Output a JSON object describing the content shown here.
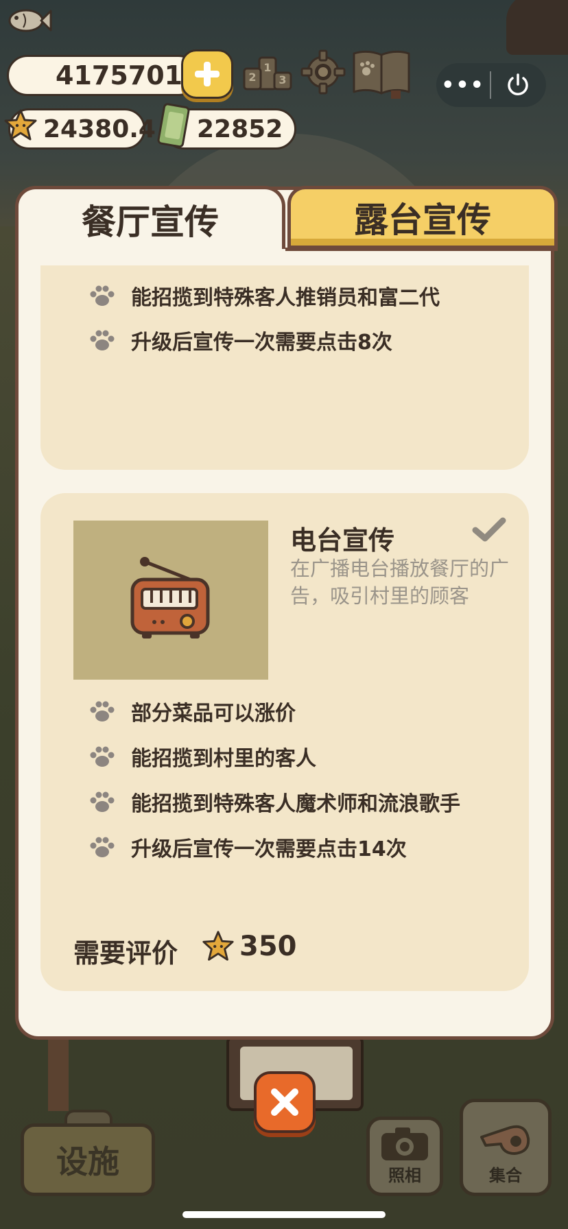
{
  "hud": {
    "fish_count": "4175701",
    "star_count": "24380.4",
    "ticket_count": "22852",
    "capsule_more": "•••"
  },
  "tabs": [
    {
      "label": "餐厅宣传",
      "active": true
    },
    {
      "label": "露台宣传",
      "active": false
    }
  ],
  "card1": {
    "bullets": [
      "能招揽到特殊客人推销员和富二代",
      "升级后宣传一次需要点击8次"
    ]
  },
  "card2": {
    "title": "电台宣传",
    "description": "在广播电台播放餐厅的广告，吸引村里的顾客",
    "checked": true,
    "bullets": [
      "部分菜品可以涨价",
      "能招揽到村里的客人",
      "能招揽到特殊客人魔术师和流浪歌手",
      "升级后宣传一次需要点击14次"
    ],
    "requirement_label": "需要评价",
    "requirement_value": "350"
  },
  "bottom": {
    "facility": "设施",
    "photo": "照相",
    "gather": "集合"
  },
  "colors": {
    "panel_border": "#6e4a3b",
    "panel_bg": "#f9f4e8",
    "card_bg": "#f3e6c9",
    "tab_inactive": "#f5cf66",
    "close_button": "#e86a2a",
    "text_dark": "#3a2e25",
    "text_muted": "#9a948a"
  },
  "icons": {
    "fish": "fish-icon",
    "plus": "plus-icon",
    "star": "star-icon",
    "ticket": "ticket-icon",
    "rank": "rank-icon",
    "gear": "gear-icon",
    "book": "book-icon",
    "power": "power-icon",
    "paw": "paw-icon",
    "radio": "radio-icon",
    "check": "check-icon",
    "close": "close-icon",
    "camera": "camera-icon",
    "whistle": "whistle-icon"
  }
}
